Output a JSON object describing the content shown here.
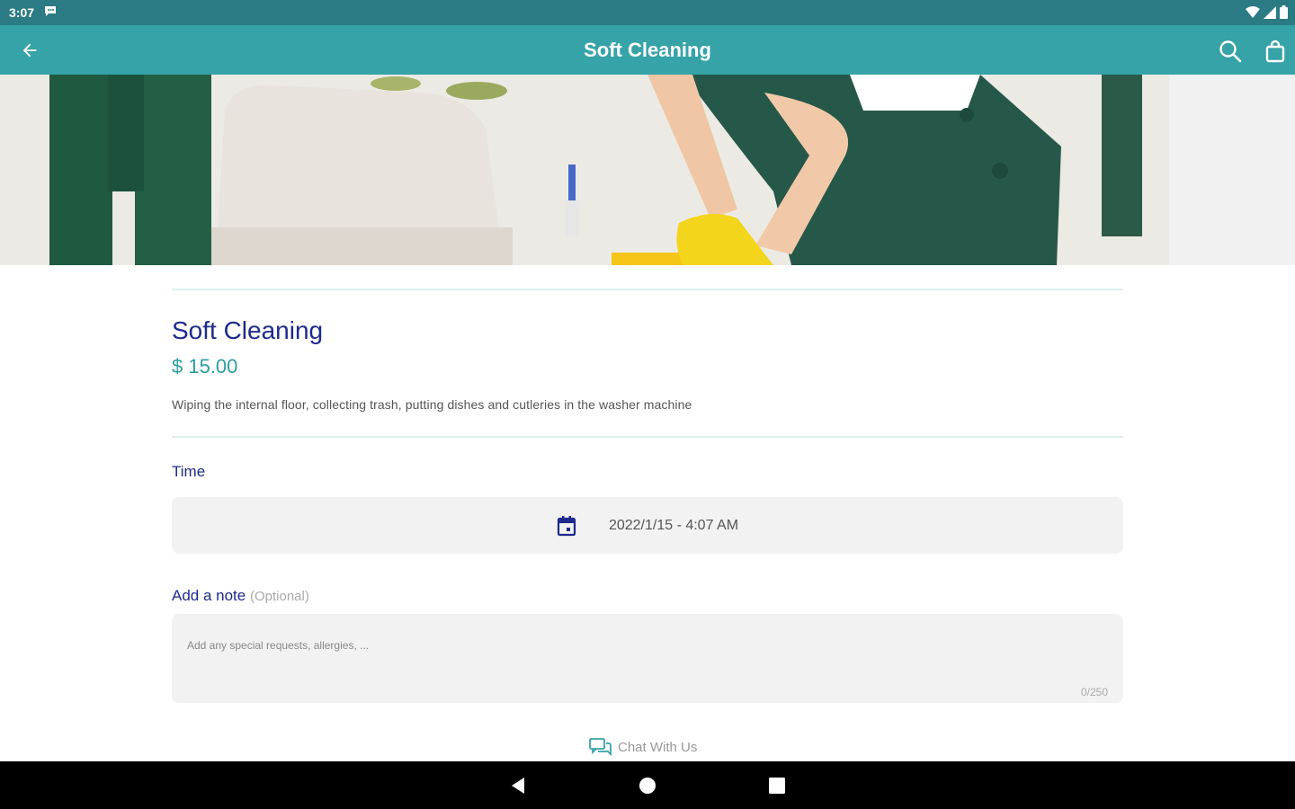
{
  "status_bar": {
    "time": "3:07"
  },
  "app_bar": {
    "title": "Soft Cleaning"
  },
  "service": {
    "title": "Soft Cleaning",
    "price": "$ 15.00",
    "description": "Wiping the internal floor, collecting trash, putting dishes and cutleries in the washer machine"
  },
  "time_section": {
    "label": "Time",
    "value": "2022/1/15 - 4:07 AM"
  },
  "note_section": {
    "label": "Add a note",
    "optional": "(Optional)",
    "placeholder": "Add any special requests, allergies, ...",
    "counter": "0/250"
  },
  "chat": {
    "label": "Chat With Us"
  },
  "colors": {
    "status_bar": "#2a7b84",
    "app_bar": "#35a3a7",
    "title_text": "#1e2a8c",
    "price_text": "#2a9d9e",
    "field_bg": "#f2f2f2"
  },
  "icons": [
    "back-arrow-icon",
    "search-icon",
    "shopping-bag-icon",
    "calendar-icon",
    "chat-icon",
    "nav-back-icon",
    "nav-home-icon",
    "nav-recents-icon"
  ]
}
